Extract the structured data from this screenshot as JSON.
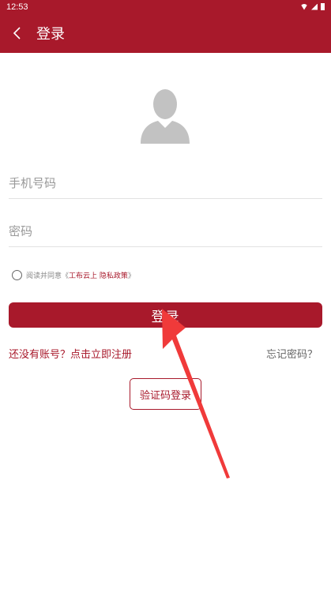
{
  "status_bar": {
    "time": "12:53"
  },
  "app_bar": {
    "title": "登录"
  },
  "form": {
    "phone_placeholder": "手机号码",
    "password_placeholder": "密码",
    "agree_prefix": "阅读并同意《",
    "agree_link": "工布云上 隐私政策",
    "agree_suffix": "》",
    "login_label": "登录",
    "register_label": "还没有账号？点击立即注册",
    "forgot_label": "忘记密码？",
    "sms_login_label": "验证码登录"
  },
  "colors": {
    "brand": "#a8192b",
    "annotation_arrow": "#f03a3a"
  },
  "icons": {
    "back": "chevron-left-icon",
    "avatar": "user-avatar-icon"
  }
}
